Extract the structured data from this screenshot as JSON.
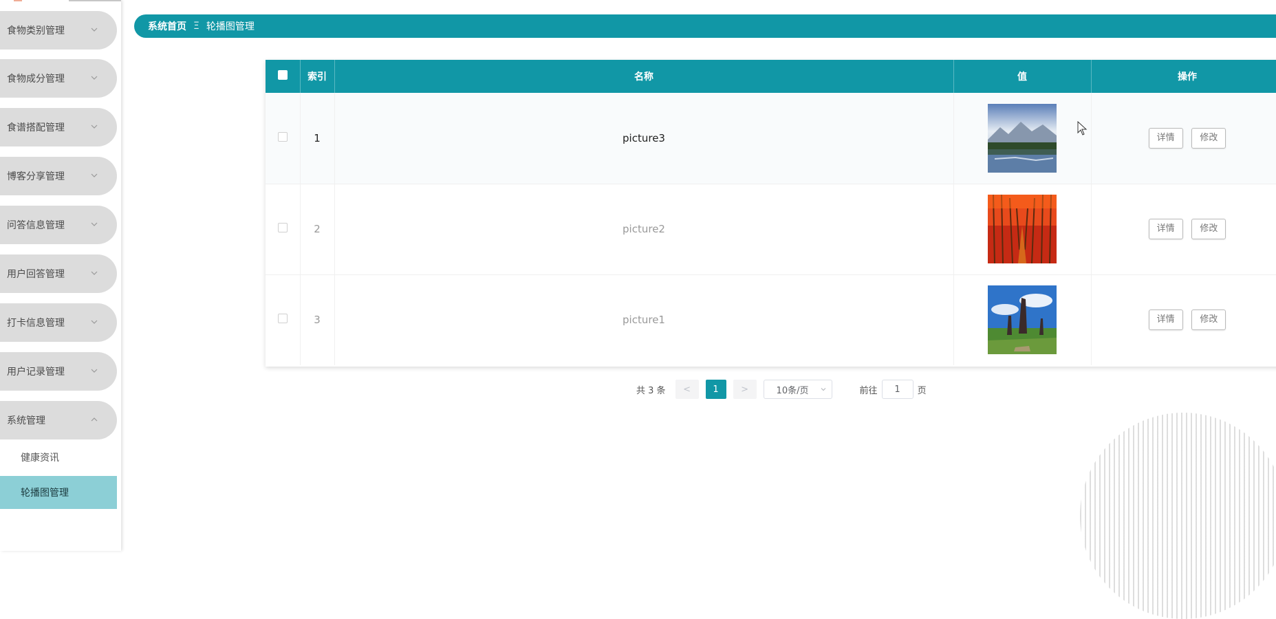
{
  "sidebar": {
    "items": [
      {
        "label": "食物类别管理"
      },
      {
        "label": "食物成分管理"
      },
      {
        "label": "食谱搭配管理"
      },
      {
        "label": "博客分享管理"
      },
      {
        "label": "问答信息管理"
      },
      {
        "label": "用户回答管理"
      },
      {
        "label": "打卡信息管理"
      },
      {
        "label": "用户记录管理"
      },
      {
        "label": "系统管理"
      }
    ],
    "sub_items": [
      {
        "label": "健康资讯"
      },
      {
        "label": "轮播图管理"
      }
    ]
  },
  "breadcrumb": {
    "home": "系统首页",
    "separator": "Ξ",
    "current": "轮播图管理"
  },
  "table": {
    "headers": {
      "index": "索引",
      "name": "名称",
      "value": "值",
      "actions": "操作"
    },
    "rows": [
      {
        "index": "1",
        "name": "picture3",
        "image": "mountain-lake"
      },
      {
        "index": "2",
        "name": "picture2",
        "image": "red-forest"
      },
      {
        "index": "3",
        "name": "picture1",
        "image": "trees-field"
      }
    ],
    "detail_label": "详情",
    "edit_label": "修改"
  },
  "pagination": {
    "total_text": "共 3 条",
    "prev": "<",
    "current_page": "1",
    "next": ">",
    "page_size": "10条/页",
    "goto_label": "前往",
    "goto_value": "1",
    "page_unit": "页"
  },
  "colors": {
    "accent": "#1197a6",
    "sidebar_active": "#8ccfd6",
    "menu_bg": "#dcdcdc"
  }
}
